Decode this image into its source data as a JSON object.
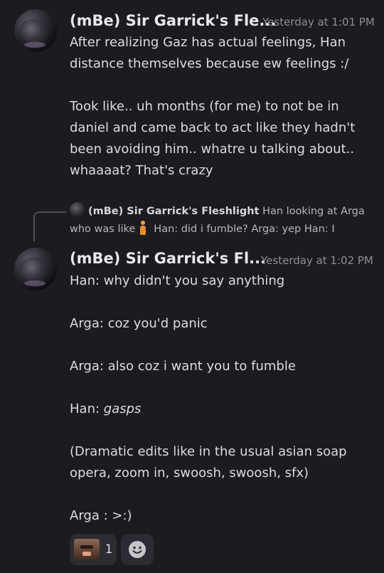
{
  "messages": [
    {
      "username": "(mBe) Sir Garrick's Fle...",
      "timestamp": "Yesterday at 1:01 PM",
      "text": "After realizing Gaz has actual feelings, Han distance themselves because ew feelings :/\n\nTook like.. uh months (for me) to not be in daniel and came back to act like they hadn't been avoiding him.. whatre u talking about.. whaaaat? That's crazy"
    },
    {
      "reply": {
        "username": "(mBe) Sir Garrick's Fleshlight",
        "text_before_emoji": "Han looking at Arga who was like",
        "emoji": "person-standing-icon",
        "text_after_emoji": "Han: did i fumble? Arga: yep Han: I"
      },
      "username": "(mBe) Sir Garrick's Fl...",
      "timestamp": "Yesterday at 1:02 PM",
      "lines": [
        {
          "text": "Han: why didn't you say anything"
        },
        {
          "text": "Arga: coz you'd panic"
        },
        {
          "text": "Arga: also coz i want you to fumble"
        },
        {
          "prefix": "Han: ",
          "italic": "gasps"
        },
        {
          "text": "(Dramatic edits like in the usual asian soap opera, zoom in, swoosh, swoosh, sfx)"
        },
        {
          "text": "Arga : >:)"
        }
      ],
      "reactions": [
        {
          "emoji": "custom-face-emoji",
          "count": "1"
        }
      ],
      "add_reaction_icon": "add-reaction-icon"
    }
  ],
  "colors": {
    "background": "#1b1b20",
    "text": "#dcdde0",
    "muted": "#8d9097",
    "reaction_bg": "#2b2c33"
  }
}
